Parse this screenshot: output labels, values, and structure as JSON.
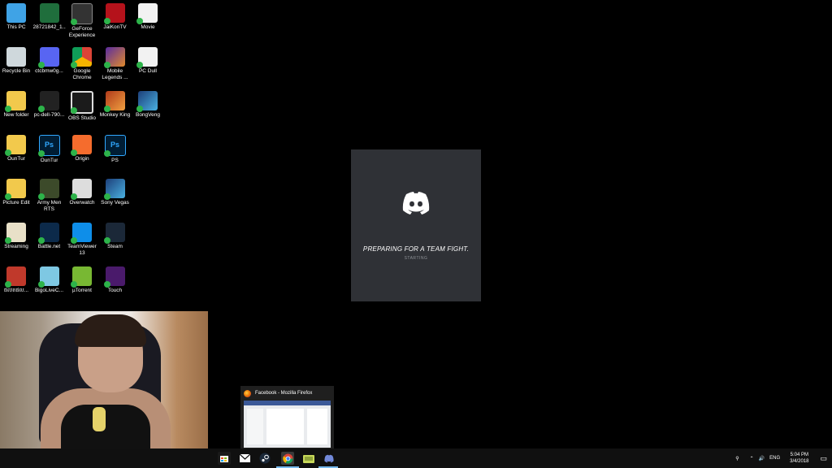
{
  "desktop": {
    "icons": [
      {
        "label": "This PC",
        "icon": "computer-icon"
      },
      {
        "label": "28721842_1...",
        "icon": "file-icon"
      },
      {
        "label": "GeForce Experience",
        "icon": "nvidia-icon"
      },
      {
        "label": "JaiKonTV",
        "icon": "jaikontv-icon"
      },
      {
        "label": "Movie",
        "icon": "document-icon"
      },
      {
        "label": "Recycle Bin",
        "icon": "recycle-bin-icon"
      },
      {
        "label": "ctcbmw0g...",
        "icon": "discord-file-icon"
      },
      {
        "label": "Google Chrome",
        "icon": "chrome-icon"
      },
      {
        "label": "Mobile Legends ...",
        "icon": "mobile-legends-icon"
      },
      {
        "label": "PC Dull",
        "icon": "document-icon"
      },
      {
        "label": "New folder",
        "icon": "folder-icon"
      },
      {
        "label": "pc-dell-790...",
        "icon": "dark-file-icon"
      },
      {
        "label": "OBS Studio",
        "icon": "obs-icon"
      },
      {
        "label": "Monkey King",
        "icon": "monkey-king-icon"
      },
      {
        "label": "BongVeng",
        "icon": "sony-vegas-file-icon"
      },
      {
        "label": "OunTur",
        "icon": "folder-icon"
      },
      {
        "label": "OunTur",
        "icon": "photoshop-icon"
      },
      {
        "label": "Origin",
        "icon": "origin-icon"
      },
      {
        "label": "PS",
        "icon": "photoshop-icon"
      },
      {
        "label": "",
        "icon": ""
      },
      {
        "label": "Picture Edit",
        "icon": "folder-icon"
      },
      {
        "label": "Army Men RTS",
        "icon": "army-men-icon"
      },
      {
        "label": "Overwatch",
        "icon": "overwatch-icon"
      },
      {
        "label": "Sony Vegas",
        "icon": "sony-vegas-icon"
      },
      {
        "label": "",
        "icon": ""
      },
      {
        "label": "Streaming",
        "icon": "streaming-folder-icon"
      },
      {
        "label": "Battle.net",
        "icon": "battlenet-icon"
      },
      {
        "label": "TeamViewer 13",
        "icon": "teamviewer-icon"
      },
      {
        "label": "Steam",
        "icon": "steam-icon"
      },
      {
        "label": "",
        "icon": ""
      },
      {
        "label": "ផលិតផល...",
        "icon": "khmer-file-icon"
      },
      {
        "label": "BigoLiveC...",
        "icon": "bigo-live-icon"
      },
      {
        "label": "µTorrent",
        "icon": "utorrent-icon"
      },
      {
        "label": "Touch",
        "icon": "touch-icon"
      }
    ]
  },
  "splash": {
    "title": "PREPARING FOR A TEAM FIGHT.",
    "status": "STARTING"
  },
  "taskbar_preview": {
    "title": "Facebook - Mozilla Firefox"
  },
  "taskbar": {
    "apps": [
      "store-icon",
      "mail-icon",
      "steam-icon",
      "chrome-icon",
      "file-explorer-icon",
      "discord-icon"
    ],
    "tray": {
      "language": "ENG",
      "time": "5:04 PM",
      "date": "3/4/2018"
    }
  }
}
